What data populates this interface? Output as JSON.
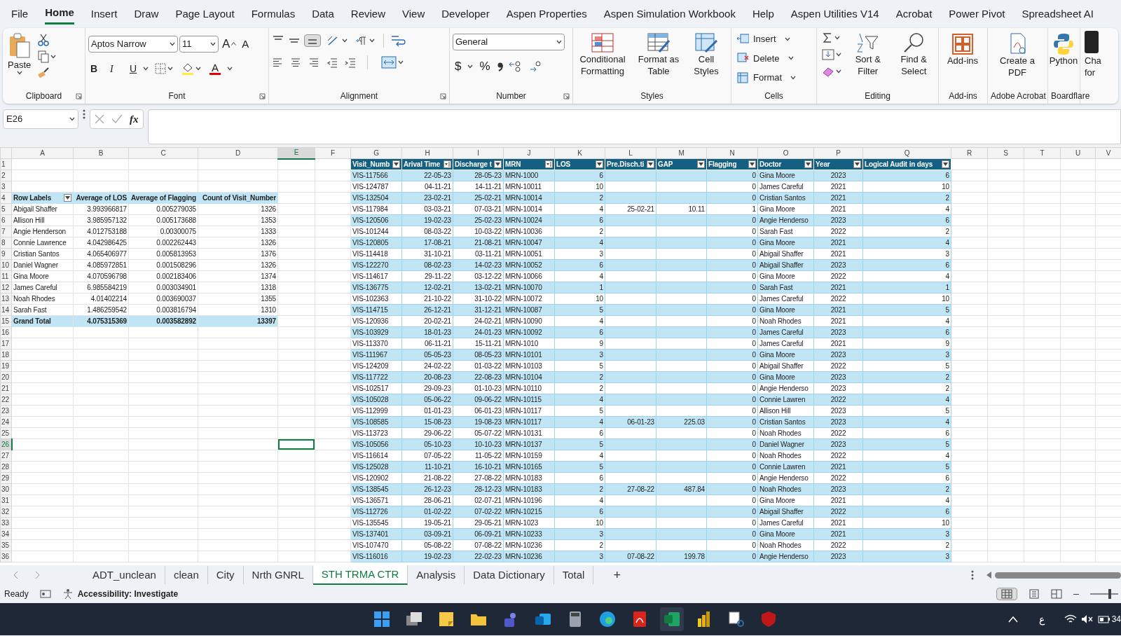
{
  "menu_tabs": [
    {
      "label": "File",
      "selected": false
    },
    {
      "label": "Home",
      "selected": true
    },
    {
      "label": "Insert",
      "selected": false
    },
    {
      "label": "Draw",
      "selected": false
    },
    {
      "label": "Page Layout",
      "selected": false
    },
    {
      "label": "Formulas",
      "selected": false
    },
    {
      "label": "Data",
      "selected": false
    },
    {
      "label": "Review",
      "selected": false
    },
    {
      "label": "View",
      "selected": false
    },
    {
      "label": "Developer",
      "selected": false
    },
    {
      "label": "Aspen Properties",
      "selected": false
    },
    {
      "label": "Aspen Simulation Workbook",
      "selected": false
    },
    {
      "label": "Help",
      "selected": false
    },
    {
      "label": "Aspen Utilities V14",
      "selected": false
    },
    {
      "label": "Acrobat",
      "selected": false
    },
    {
      "label": "Power Pivot",
      "selected": false
    },
    {
      "label": "Spreadsheet AI",
      "selected": false
    }
  ],
  "ribbon": {
    "clipboard": {
      "label": "Clipboard",
      "launcher": true,
      "paste": "Paste"
    },
    "font": {
      "label": "Font",
      "launcher": true,
      "font_name": "Aptos Narrow",
      "font_size": "11",
      "grow": "A",
      "shrink": "A",
      "bold": "B",
      "italic": "I",
      "underline": "U",
      "font_color": "A"
    },
    "alignment": {
      "label": "Alignment",
      "launcher": true
    },
    "number": {
      "label": "Number",
      "launcher": true,
      "format": "General",
      "currency": "$",
      "percent": "%"
    },
    "styles": {
      "label": "Styles",
      "launcher": false,
      "buttons": [
        "Conditional Formatting",
        "Format as Table",
        "Cell Styles"
      ]
    },
    "cells": {
      "label": "Cells",
      "launcher": false,
      "buttons": [
        "Insert",
        "Delete",
        "Format"
      ]
    },
    "editing": {
      "label": "Editing",
      "launcher": false,
      "buttons": [
        "Sort & Filter",
        "Find & Select"
      ]
    },
    "addins": {
      "label": "Add-ins",
      "launcher": false,
      "buttons": [
        "Add-ins"
      ]
    },
    "acrobat": {
      "label": "Adobe Acrobat",
      "launcher": false,
      "buttons": [
        "Create a PDF"
      ]
    },
    "boardflare": {
      "label": "Boardflare",
      "launcher": false,
      "buttons": [
        "Python"
      ]
    },
    "cut_off_button": "Cha for"
  },
  "formula_bar": {
    "name_box": "E26",
    "fx": "fx"
  },
  "columns": [
    {
      "label": "A",
      "selected": false
    },
    {
      "label": "B",
      "selected": false
    },
    {
      "label": "C",
      "selected": false
    },
    {
      "label": "D",
      "selected": false
    },
    {
      "label": "E",
      "selected": true
    },
    {
      "label": "F",
      "selected": false
    },
    {
      "label": "G",
      "selected": false
    },
    {
      "label": "H",
      "selected": false
    },
    {
      "label": "I",
      "selected": false
    },
    {
      "label": "J",
      "selected": false
    },
    {
      "label": "K",
      "selected": false
    },
    {
      "label": "L",
      "selected": false
    },
    {
      "label": "M",
      "selected": false
    },
    {
      "label": "N",
      "selected": false
    },
    {
      "label": "O",
      "selected": false
    },
    {
      "label": "P",
      "selected": false
    },
    {
      "label": "Q",
      "selected": false
    },
    {
      "label": "R",
      "selected": false
    },
    {
      "label": "S",
      "selected": false
    },
    {
      "label": "T",
      "selected": false
    },
    {
      "label": "U",
      "selected": false
    },
    {
      "label": "V",
      "selected": false
    }
  ],
  "row_numbers": [
    {
      "label": "1",
      "selected": false
    },
    {
      "label": "2",
      "selected": false
    },
    {
      "label": "3",
      "selected": false
    },
    {
      "label": "4",
      "selected": false
    },
    {
      "label": "5",
      "selected": false
    },
    {
      "label": "6",
      "selected": false
    },
    {
      "label": "7",
      "selected": false
    },
    {
      "label": "8",
      "selected": false
    },
    {
      "label": "9",
      "selected": false
    },
    {
      "label": "10",
      "selected": false
    },
    {
      "label": "11",
      "selected": false
    },
    {
      "label": "12",
      "selected": false
    },
    {
      "label": "13",
      "selected": false
    },
    {
      "label": "14",
      "selected": false
    },
    {
      "label": "15",
      "selected": false
    },
    {
      "label": "16",
      "selected": false
    },
    {
      "label": "17",
      "selected": false
    },
    {
      "label": "18",
      "selected": false
    },
    {
      "label": "19",
      "selected": false
    },
    {
      "label": "20",
      "selected": false
    },
    {
      "label": "21",
      "selected": false
    },
    {
      "label": "22",
      "selected": false
    },
    {
      "label": "23",
      "selected": false
    },
    {
      "label": "24",
      "selected": false
    },
    {
      "label": "25",
      "selected": false
    },
    {
      "label": "26",
      "selected": true
    },
    {
      "label": "27",
      "selected": false
    },
    {
      "label": "28",
      "selected": false
    },
    {
      "label": "29",
      "selected": false
    },
    {
      "label": "30",
      "selected": false
    },
    {
      "label": "31",
      "selected": false
    },
    {
      "label": "32",
      "selected": false
    },
    {
      "label": "33",
      "selected": false
    },
    {
      "label": "34",
      "selected": false
    },
    {
      "label": "35",
      "selected": false
    },
    {
      "label": "36",
      "selected": false
    }
  ],
  "pivot": {
    "header": [
      "Row Labels",
      "Average of LOS",
      "Average of Flagging",
      "Count of Visit_Number"
    ],
    "rows": [
      [
        "Abigail Shaffer",
        "3.993966817",
        "0.005279035",
        "1326"
      ],
      [
        "Allison Hill",
        "3.985957132",
        "0.005173688",
        "1353"
      ],
      [
        "Angie Henderson",
        "4.012753188",
        "0.00300075",
        "1333"
      ],
      [
        "Connie Lawrence",
        "4.042986425",
        "0.002262443",
        "1326"
      ],
      [
        "Cristian Santos",
        "4.065406977",
        "0.005813953",
        "1376"
      ],
      [
        "Daniel Wagner",
        "4.085972851",
        "0.001508296",
        "1326"
      ],
      [
        "Gina Moore",
        "4.070596798",
        "0.002183406",
        "1374"
      ],
      [
        "James Careful",
        "6.985584219",
        "0.003034901",
        "1318"
      ],
      [
        "Noah Rhodes",
        "4.01402214",
        "0.003690037",
        "1355"
      ],
      [
        "Sarah Fast",
        "1.486259542",
        "0.003816794",
        "1310"
      ]
    ],
    "total": [
      "Grand Total",
      "4.075315369",
      "0.003582892",
      "13397"
    ]
  },
  "table": {
    "columns": [
      {
        "label": "Visit_Numb",
        "sorted": false
      },
      {
        "label": "Arival Time",
        "sorted": true
      },
      {
        "label": "Discharge t",
        "sorted": false
      },
      {
        "label": "MRN",
        "sorted": true
      },
      {
        "label": "LOS",
        "sorted": false
      },
      {
        "label": "Pre.Disch.ti",
        "sorted": false
      },
      {
        "label": "GAP",
        "sorted": false
      },
      {
        "label": "Flagging",
        "sorted": false
      },
      {
        "label": "Doctor",
        "sorted": false
      },
      {
        "label": "Year",
        "sorted": false
      },
      {
        "label": "Logical Audit in days",
        "sorted": false
      }
    ],
    "rows": [
      [
        "VIS-117566",
        "22-05-23",
        "28-05-23",
        "MRN-1000",
        "6",
        null,
        null,
        "0",
        "Gina Moore",
        "2023",
        "6"
      ],
      [
        "VIS-124787",
        "04-11-21",
        "14-11-21",
        "MRN-10011",
        "10",
        null,
        null,
        "0",
        "James Careful",
        "2021",
        "10"
      ],
      [
        "VIS-132504",
        "23-02-21",
        "25-02-21",
        "MRN-10014",
        "2",
        null,
        null,
        "0",
        "Cristian Santos",
        "2021",
        "2"
      ],
      [
        "VIS-117984",
        "03-03-21",
        "07-03-21",
        "MRN-10014",
        "4",
        "25-02-21",
        "10.11",
        "1",
        "Gina Moore",
        "2021",
        "4"
      ],
      [
        "VIS-120506",
        "19-02-23",
        "25-02-23",
        "MRN-10024",
        "6",
        null,
        null,
        "0",
        "Angie Henderso",
        "2023",
        "6"
      ],
      [
        "VIS-101244",
        "08-03-22",
        "10-03-22",
        "MRN-10036",
        "2",
        null,
        null,
        "0",
        "Sarah Fast",
        "2022",
        "2"
      ],
      [
        "VIS-120805",
        "17-08-21",
        "21-08-21",
        "MRN-10047",
        "4",
        null,
        null,
        "0",
        "Gina Moore",
        "2021",
        "4"
      ],
      [
        "VIS-114418",
        "31-10-21",
        "03-11-21",
        "MRN-10051",
        "3",
        null,
        null,
        "0",
        "Abigail Shaffer",
        "2021",
        "3"
      ],
      [
        "VIS-122270",
        "08-02-23",
        "14-02-23",
        "MRN-10052",
        "6",
        null,
        null,
        "0",
        "Abigail Shaffer",
        "2023",
        "6"
      ],
      [
        "VIS-114617",
        "29-11-22",
        "03-12-22",
        "MRN-10066",
        "4",
        null,
        null,
        "0",
        "Gina Moore",
        "2022",
        "4"
      ],
      [
        "VIS-136775",
        "12-02-21",
        "13-02-21",
        "MRN-10070",
        "1",
        null,
        null,
        "0",
        "Sarah Fast",
        "2021",
        "1"
      ],
      [
        "VIS-102363",
        "21-10-22",
        "31-10-22",
        "MRN-10072",
        "10",
        null,
        null,
        "0",
        "James Careful",
        "2022",
        "10"
      ],
      [
        "VIS-114715",
        "26-12-21",
        "31-12-21",
        "MRN-10087",
        "5",
        null,
        null,
        "0",
        "Gina Moore",
        "2021",
        "5"
      ],
      [
        "VIS-120936",
        "20-02-21",
        "24-02-21",
        "MRN-10090",
        "4",
        null,
        null,
        "0",
        "Noah Rhodes",
        "2021",
        "4"
      ],
      [
        "VIS-103929",
        "18-01-23",
        "24-01-23",
        "MRN-10092",
        "6",
        null,
        null,
        "0",
        "James Careful",
        "2023",
        "6"
      ],
      [
        "VIS-113370",
        "06-11-21",
        "15-11-21",
        "MRN-1010",
        "9",
        null,
        null,
        "0",
        "James Careful",
        "2021",
        "9"
      ],
      [
        "VIS-111967",
        "05-05-23",
        "08-05-23",
        "MRN-10101",
        "3",
        null,
        null,
        "0",
        "Gina Moore",
        "2023",
        "3"
      ],
      [
        "VIS-124209",
        "24-02-22",
        "01-03-22",
        "MRN-10103",
        "5",
        null,
        null,
        "0",
        "Abigail Shaffer",
        "2022",
        "5"
      ],
      [
        "VIS-117722",
        "20-08-23",
        "22-08-23",
        "MRN-10104",
        "2",
        null,
        null,
        "0",
        "Gina Moore",
        "2023",
        "2"
      ],
      [
        "VIS-102517",
        "29-09-23",
        "01-10-23",
        "MRN-10110",
        "2",
        null,
        null,
        "0",
        "Angie Henderso",
        "2023",
        "2"
      ],
      [
        "VIS-105028",
        "05-06-22",
        "09-06-22",
        "MRN-10115",
        "4",
        null,
        null,
        "0",
        "Connie Lawren",
        "2022",
        "4"
      ],
      [
        "VIS-112999",
        "01-01-23",
        "06-01-23",
        "MRN-10117",
        "5",
        null,
        null,
        "0",
        "Allison Hill",
        "2023",
        "5"
      ],
      [
        "VIS-108585",
        "15-08-23",
        "19-08-23",
        "MRN-10117",
        "4",
        "06-01-23",
        "225.03",
        "0",
        "Cristian Santos",
        "2023",
        "4"
      ],
      [
        "VIS-113723",
        "29-06-22",
        "05-07-22",
        "MRN-10131",
        "6",
        null,
        null,
        "0",
        "Noah Rhodes",
        "2022",
        "6"
      ],
      [
        "VIS-105056",
        "05-10-23",
        "10-10-23",
        "MRN-10137",
        "5",
        null,
        null,
        "0",
        "Daniel Wagner",
        "2023",
        "5"
      ],
      [
        "VIS-116614",
        "07-05-22",
        "11-05-22",
        "MRN-10159",
        "4",
        null,
        null,
        "0",
        "Noah Rhodes",
        "2022",
        "4"
      ],
      [
        "VIS-125028",
        "11-10-21",
        "16-10-21",
        "MRN-10165",
        "5",
        null,
        null,
        "0",
        "Connie Lawren",
        "2021",
        "5"
      ],
      [
        "VIS-120902",
        "21-08-22",
        "27-08-22",
        "MRN-10183",
        "6",
        null,
        null,
        "0",
        "Angie Henderso",
        "2022",
        "6"
      ],
      [
        "VIS-138545",
        "26-12-23",
        "28-12-23",
        "MRN-10183",
        "2",
        "27-08-22",
        "487.84",
        "0",
        "Noah Rhodes",
        "2023",
        "2"
      ],
      [
        "VIS-136571",
        "28-06-21",
        "02-07-21",
        "MRN-10196",
        "4",
        null,
        null,
        "0",
        "Gina Moore",
        "2021",
        "4"
      ],
      [
        "VIS-112726",
        "01-02-22",
        "07-02-22",
        "MRN-10215",
        "6",
        null,
        null,
        "0",
        "Abigail Shaffer",
        "2022",
        "6"
      ],
      [
        "VIS-135545",
        "19-05-21",
        "29-05-21",
        "MRN-1023",
        "10",
        null,
        null,
        "0",
        "James Careful",
        "2021",
        "10"
      ],
      [
        "VIS-137401",
        "03-09-21",
        "06-09-21",
        "MRN-10233",
        "3",
        null,
        null,
        "0",
        "Gina Moore",
        "2021",
        "3"
      ],
      [
        "VIS-107470",
        "05-08-22",
        "07-08-22",
        "MRN-10236",
        "2",
        null,
        null,
        "0",
        "Noah Rhodes",
        "2022",
        "2"
      ],
      [
        "VIS-116016",
        "19-02-23",
        "22-02-23",
        "MRN-10236",
        "3",
        "07-08-22",
        "199.78",
        "0",
        "Angie Henderso",
        "2023",
        "3"
      ]
    ]
  },
  "sheet_tabs": [
    {
      "label": "ADT_unclean",
      "selected": false
    },
    {
      "label": "clean",
      "selected": false
    },
    {
      "label": "City",
      "selected": false
    },
    {
      "label": "Nrth GNRL",
      "selected": false
    },
    {
      "label": "STH TRMA CTR",
      "selected": true
    },
    {
      "label": "Analysis",
      "selected": false
    },
    {
      "label": "Data Dictionary",
      "selected": false
    },
    {
      "label": "Total",
      "selected": false
    }
  ],
  "add_sheet": "+",
  "status_bar": {
    "ready": "Ready",
    "accessibility": "Accessibility: Investigate",
    "zoom": {
      "level": 0.7
    }
  },
  "taskbar": {
    "input_language": "ع",
    "battery": "34"
  }
}
